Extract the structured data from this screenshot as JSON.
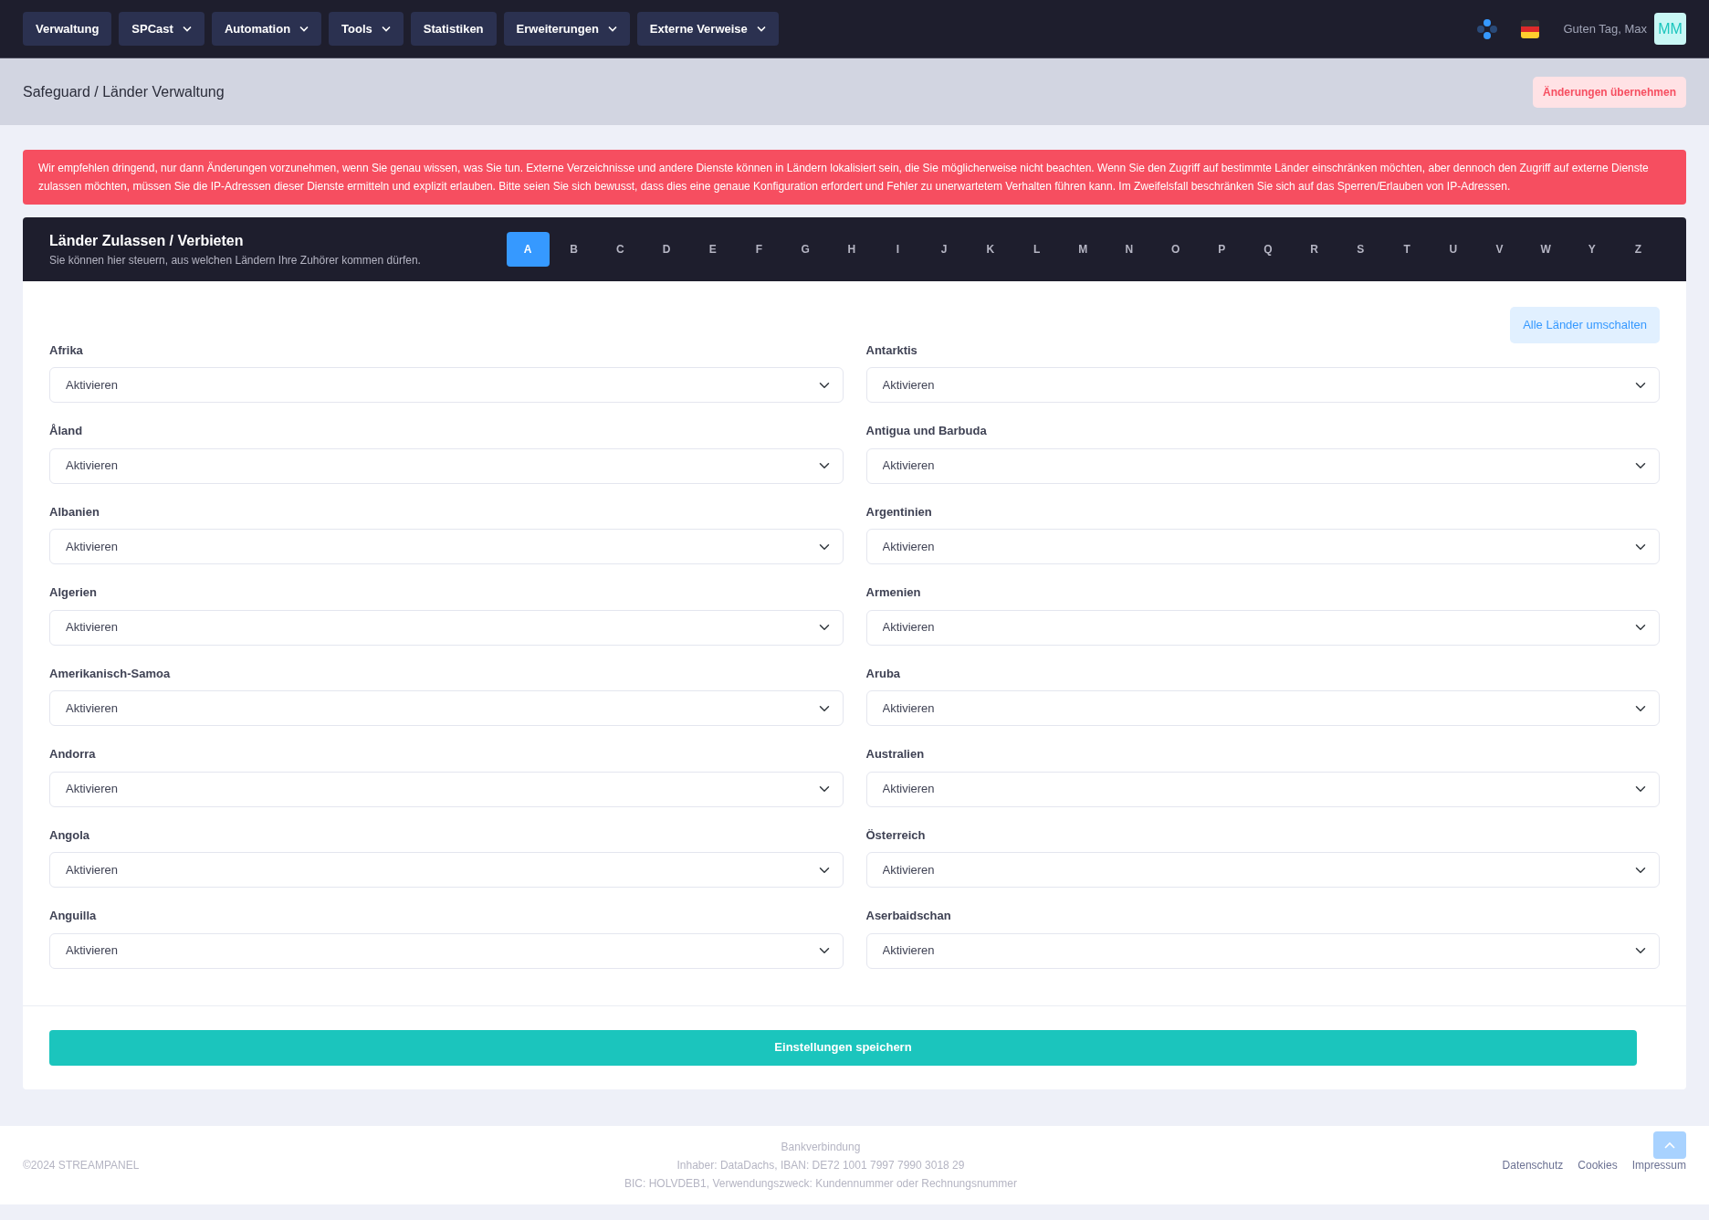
{
  "nav": {
    "items": [
      {
        "label": "Verwaltung",
        "dropdown": false
      },
      {
        "label": "SPCast",
        "dropdown": true
      },
      {
        "label": "Automation",
        "dropdown": true
      },
      {
        "label": "Tools",
        "dropdown": true
      },
      {
        "label": "Statistiken",
        "dropdown": false
      },
      {
        "label": "Erweiterungen",
        "dropdown": true
      },
      {
        "label": "Externe Verweise",
        "dropdown": true
      }
    ],
    "greeting": "Guten Tag, Max",
    "avatar": "MM"
  },
  "header": {
    "breadcrumb": "Safeguard / Länder Verwaltung",
    "apply_button": "Änderungen übernehmen"
  },
  "alert": "Wir empfehlen dringend, nur dann Änderungen vorzunehmen, wenn Sie genau wissen, was Sie tun. Externe Verzeichnisse und andere Dienste können in Ländern lokalisiert sein, die Sie möglicherweise nicht beachten. Wenn Sie den Zugriff auf bestimmte Länder einschränken möchten, aber dennoch den Zugriff auf externe Dienste zulassen möchten, müssen Sie die IP-Adressen dieser Dienste ermitteln und explizit erlauben. Bitte seien Sie sich bewusst, dass dies eine genaue Konfiguration erfordert und Fehler zu unerwartetem Verhalten führen kann. Im Zweifelsfall beschränken Sie sich auf das Sperren/Erlauben von IP-Adressen.",
  "card": {
    "title": "Länder Zulassen / Verbieten",
    "subtitle": "Sie können hier steuern, aus welchen Ländern Ihre Zuhörer kommen dürfen.",
    "letters": [
      {
        "label": "A",
        "selected": true
      },
      {
        "label": "B",
        "selected": false
      },
      {
        "label": "C",
        "selected": false
      },
      {
        "label": "D",
        "selected": false
      },
      {
        "label": "E",
        "selected": false
      },
      {
        "label": "F",
        "selected": false
      },
      {
        "label": "G",
        "selected": false
      },
      {
        "label": "H",
        "selected": false
      },
      {
        "label": "I",
        "selected": false
      },
      {
        "label": "J",
        "selected": false
      },
      {
        "label": "K",
        "selected": false
      },
      {
        "label": "L",
        "selected": false
      },
      {
        "label": "M",
        "selected": false
      },
      {
        "label": "N",
        "selected": false
      },
      {
        "label": "O",
        "selected": false
      },
      {
        "label": "P",
        "selected": false
      },
      {
        "label": "Q",
        "selected": false
      },
      {
        "label": "R",
        "selected": false
      },
      {
        "label": "S",
        "selected": false
      },
      {
        "label": "T",
        "selected": false
      },
      {
        "label": "U",
        "selected": false
      },
      {
        "label": "V",
        "selected": false
      },
      {
        "label": "W",
        "selected": false
      },
      {
        "label": "Y",
        "selected": false
      },
      {
        "label": "Z",
        "selected": false
      }
    ],
    "toggle_all": "Alle Länder umschalten",
    "countries": [
      {
        "name": "Afrika",
        "value": "Aktivieren"
      },
      {
        "name": "Antarktis",
        "value": "Aktivieren"
      },
      {
        "name": "Åland",
        "value": "Aktivieren"
      },
      {
        "name": "Antigua und Barbuda",
        "value": "Aktivieren"
      },
      {
        "name": "Albanien",
        "value": "Aktivieren"
      },
      {
        "name": "Argentinien",
        "value": "Aktivieren"
      },
      {
        "name": "Algerien",
        "value": "Aktivieren"
      },
      {
        "name": "Armenien",
        "value": "Aktivieren"
      },
      {
        "name": "Amerikanisch-Samoa",
        "value": "Aktivieren"
      },
      {
        "name": "Aruba",
        "value": "Aktivieren"
      },
      {
        "name": "Andorra",
        "value": "Aktivieren"
      },
      {
        "name": "Australien",
        "value": "Aktivieren"
      },
      {
        "name": "Angola",
        "value": "Aktivieren"
      },
      {
        "name": "Österreich",
        "value": "Aktivieren"
      },
      {
        "name": "Anguilla",
        "value": "Aktivieren"
      },
      {
        "name": "Aserbaidschan",
        "value": "Aktivieren"
      }
    ],
    "save_button": "Einstellungen speichern"
  },
  "footer": {
    "copyright": "©2024 STREAMPANEL",
    "bank": [
      "Bankverbindung",
      "Inhaber: DataDachs, IBAN: DE72 1001 7997 7990 3018 29",
      "BIC: HOLVDEB1, Verwendungszweck: Kundennummer oder Rechnungsnummer"
    ],
    "links": [
      "Datenschutz",
      "Cookies",
      "Impressum"
    ]
  }
}
